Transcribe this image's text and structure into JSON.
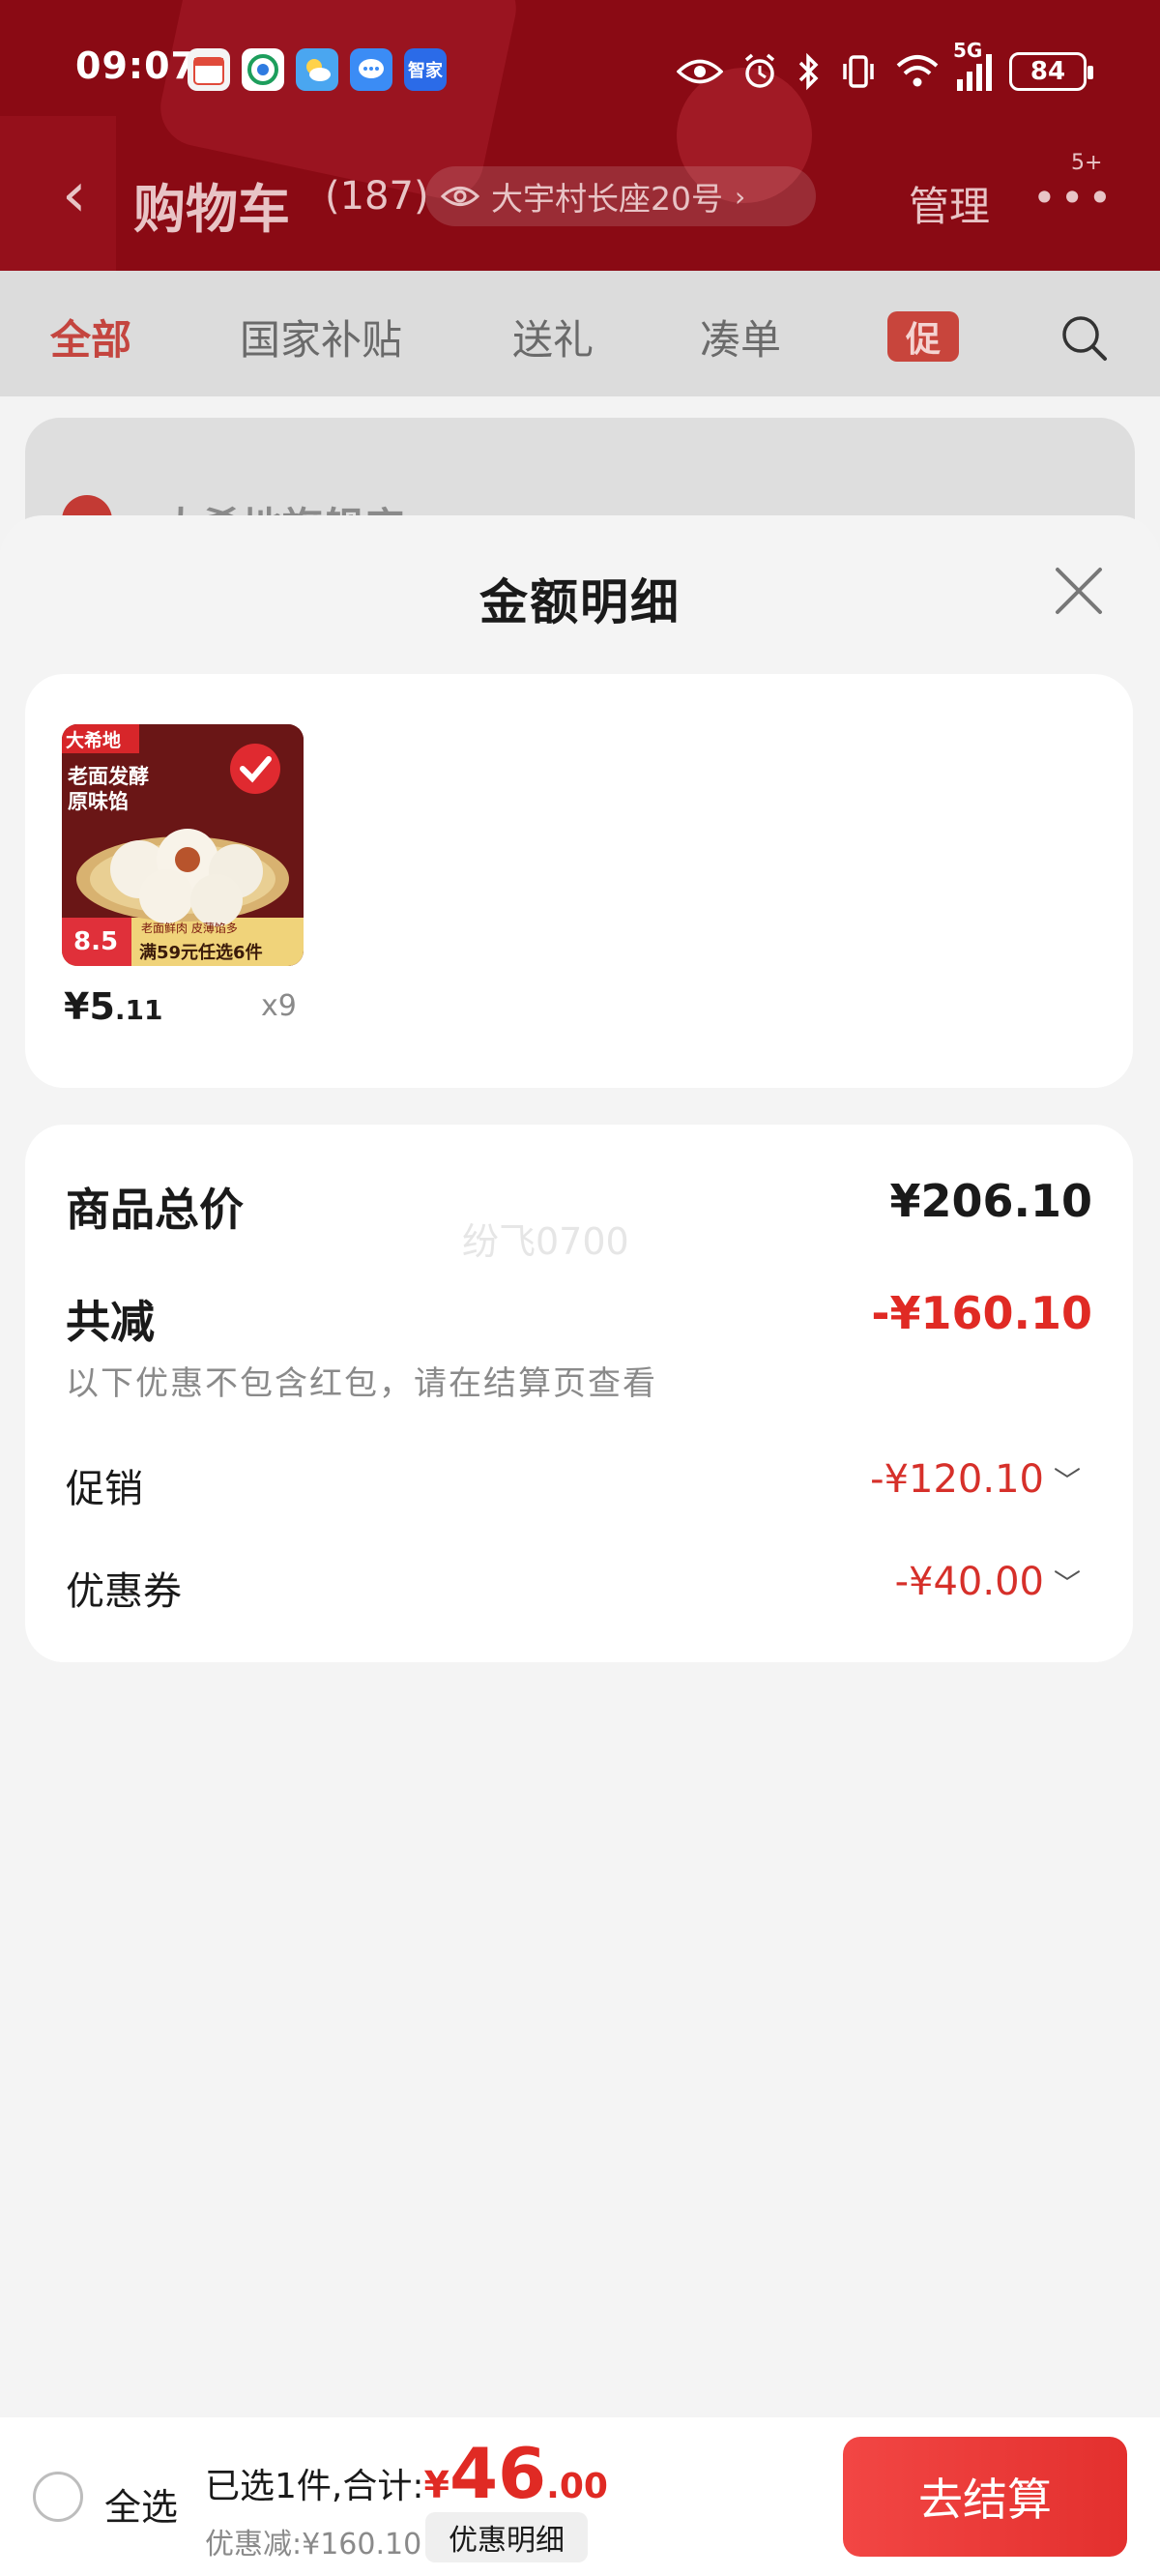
{
  "status_bar": {
    "time": "09:07",
    "battery": "84",
    "network": "5G",
    "apps": [
      {
        "name": "calendar-app-icon",
        "color": "#f2f2f2"
      },
      {
        "name": "mobile-carrier-app-icon",
        "color": "#ffffff"
      },
      {
        "name": "weather-app-icon",
        "color": "#4aa6f0"
      },
      {
        "name": "messages-app-icon",
        "color": "#3b8cf5"
      },
      {
        "name": "haier-smart-home-app-icon",
        "color": "#2b6be8",
        "label": "智家"
      }
    ]
  },
  "nav": {
    "title": "购物车",
    "count": "(187)",
    "address": "大宇村长座20号",
    "manage": "管理",
    "more_badge": "5+"
  },
  "tabs": [
    {
      "label": "全部",
      "active": true
    },
    {
      "label": "国家补贴",
      "active": false
    },
    {
      "label": "送礼",
      "active": false
    },
    {
      "label": "凑单",
      "active": false
    }
  ],
  "promo_tab": "促",
  "background_store": "大希地旗舰店",
  "sheet": {
    "title": "金额明细",
    "product": {
      "brand": "大希地",
      "image_text_1": "老面发酵",
      "image_text_2": "原味馅",
      "image_promo_price": "8.5",
      "image_promo_text": "满59元任选6件",
      "image_promo_small": "老面鲜肉 皮薄馅多",
      "price_int": "¥5",
      "price_dec": ".11",
      "quantity": "x9"
    },
    "summary": {
      "total_label": "商品总价",
      "total_value": "¥206.10",
      "reduce_label": "共减",
      "reduce_value": "-¥160.10",
      "note": "以下优惠不包含红包，请在结算页查看",
      "promo_label": "促销",
      "promo_value": "-¥120.10",
      "coupon_label": "优惠券",
      "coupon_value": "-¥40.00",
      "watermark": "纷飞0700"
    }
  },
  "bottom": {
    "select_all": "全选",
    "selected_text": "已选1件,合计:",
    "currency": "¥",
    "total_int": "46",
    "total_dec": ".00",
    "discount_text": "优惠减:¥160.10",
    "detail_button": "优惠明细",
    "checkout_button": "去结算"
  },
  "colors": {
    "brand_red": "#e02a24",
    "header_red": "#8a0a14",
    "checkout_gradient_start": "#f24644"
  }
}
